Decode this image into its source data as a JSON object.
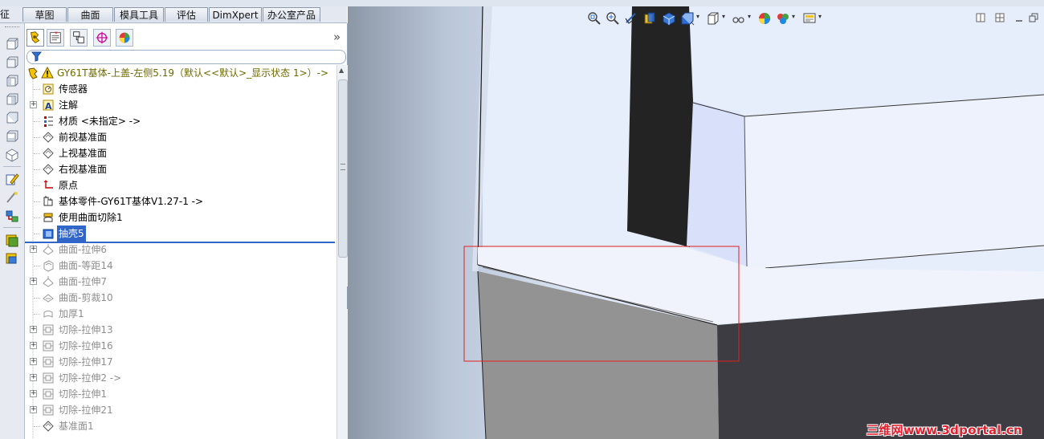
{
  "tabs": {
    "feature_partial": "征",
    "sketch": "草图",
    "surfaces": "曲面",
    "mold_tools": "模具工具",
    "evaluate": "评估",
    "dimxpert": "DimXpert",
    "office_products": "办公室产品"
  },
  "panel": {
    "collapse_glyph": "»"
  },
  "tree": {
    "root": "GY61T基体-上盖-左侧5.19（默认<<默认>_显示状态 1>）->",
    "items": [
      {
        "label": "传感器",
        "icon": "sensor-icon",
        "expandable": false,
        "state": "normal"
      },
      {
        "label": "注解",
        "icon": "annotation-icon",
        "expandable": true,
        "state": "normal"
      },
      {
        "label": "材质 <未指定> ->",
        "icon": "material-icon",
        "expandable": false,
        "state": "normal"
      },
      {
        "label": "前视基准面",
        "icon": "plane-icon",
        "expandable": false,
        "state": "normal"
      },
      {
        "label": "上视基准面",
        "icon": "plane-icon",
        "expandable": false,
        "state": "normal"
      },
      {
        "label": "右视基准面",
        "icon": "plane-icon",
        "expandable": false,
        "state": "normal"
      },
      {
        "label": "原点",
        "icon": "origin-icon",
        "expandable": false,
        "state": "normal"
      },
      {
        "label": "基体零件-GY61T基体V1.27-1 ->",
        "icon": "base-part-icon",
        "expandable": false,
        "state": "normal"
      },
      {
        "label": "使用曲面切除1",
        "icon": "surface-cut-icon",
        "expandable": false,
        "state": "normal"
      },
      {
        "label": "抽壳5",
        "icon": "shell-icon",
        "expandable": false,
        "state": "selected"
      },
      {
        "label": "曲面-拉伸6",
        "icon": "surface-extrude-icon",
        "expandable": true,
        "state": "suppressed"
      },
      {
        "label": "曲面-等距14",
        "icon": "surface-offset-icon",
        "expandable": false,
        "state": "suppressed"
      },
      {
        "label": "曲面-拉伸7",
        "icon": "surface-extrude-icon",
        "expandable": true,
        "state": "suppressed"
      },
      {
        "label": "曲面-剪裁10",
        "icon": "surface-trim-icon",
        "expandable": false,
        "state": "suppressed"
      },
      {
        "label": "加厚1",
        "icon": "thicken-icon",
        "expandable": false,
        "state": "suppressed"
      },
      {
        "label": "切除-拉伸13",
        "icon": "cut-extrude-icon",
        "expandable": true,
        "state": "suppressed"
      },
      {
        "label": "切除-拉伸16",
        "icon": "cut-extrude-icon",
        "expandable": true,
        "state": "suppressed"
      },
      {
        "label": "切除-拉伸17",
        "icon": "cut-extrude-icon",
        "expandable": true,
        "state": "suppressed"
      },
      {
        "label": "切除-拉伸2 ->",
        "icon": "cut-extrude-icon",
        "expandable": true,
        "state": "suppressed"
      },
      {
        "label": "切除-拉伸1",
        "icon": "cut-extrude-icon",
        "expandable": true,
        "state": "suppressed"
      },
      {
        "label": "切除-拉伸21",
        "icon": "cut-extrude-icon",
        "expandable": true,
        "state": "suppressed"
      },
      {
        "label": "基准面1",
        "icon": "plane-icon",
        "expandable": false,
        "state": "suppressed"
      }
    ]
  },
  "viewport": {
    "watermark": "三维网www.3dportal.cn",
    "highlight_color": "#e02020"
  },
  "colors": {
    "selection": "#3166c9",
    "suppressed_text": "#8e8e8e",
    "root_text": "#6d6a00"
  }
}
